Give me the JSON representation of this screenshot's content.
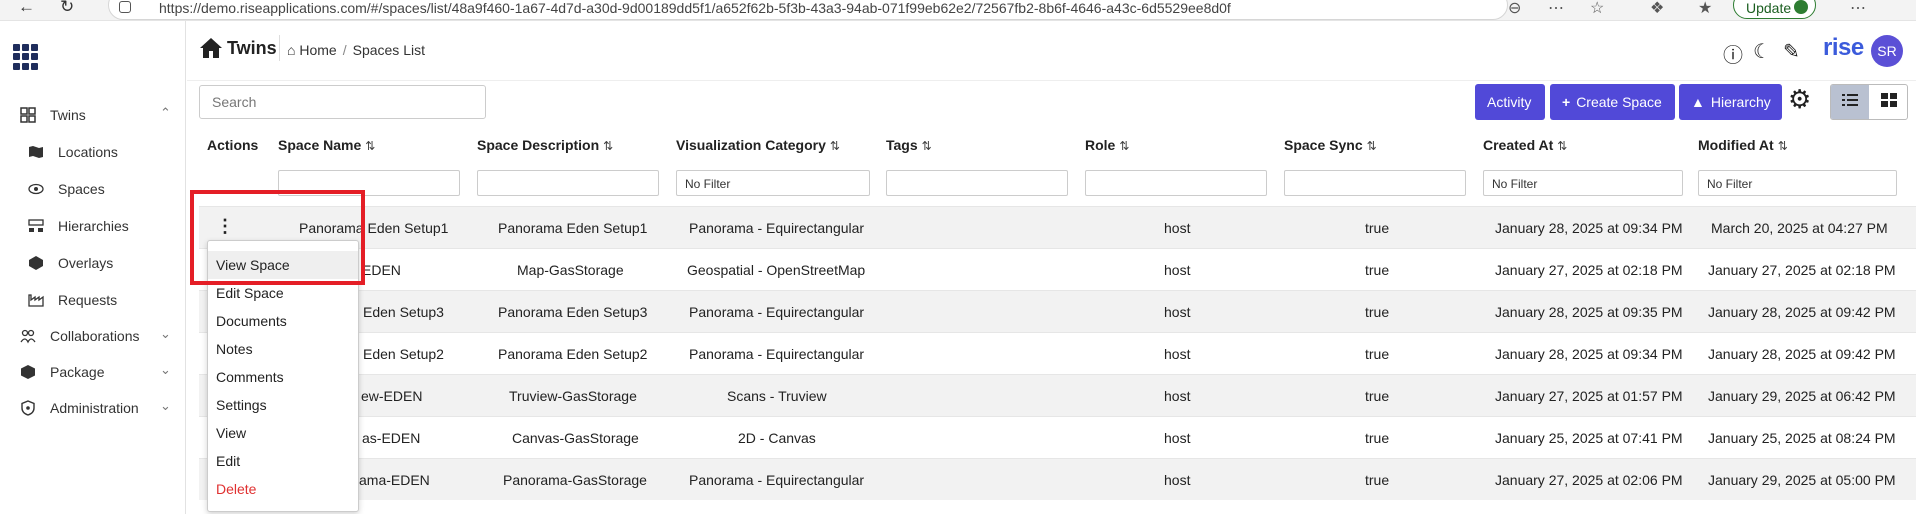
{
  "browser": {
    "url": "https://demo.riseapplications.com/#/spaces/list/48a9f460-1a67-4d7d-a30d-9d00189dd5f1/a652f62b-5f3b-43a3-94ab-071f99eb62e2/72567fb2-8b6f-4646-a43c-6d5529ee8d0f",
    "update_label": "Update"
  },
  "sidebar": {
    "items": [
      {
        "label": "Twins",
        "icon": "grid-icon"
      },
      {
        "label": "Locations",
        "icon": "map-icon"
      },
      {
        "label": "Spaces",
        "icon": "eye-icon"
      },
      {
        "label": "Hierarchies",
        "icon": "hierarchy-icon"
      },
      {
        "label": "Overlays",
        "icon": "layers-icon"
      },
      {
        "label": "Requests",
        "icon": "factory-icon"
      },
      {
        "label": "Collaborations",
        "icon": "people-icon"
      },
      {
        "label": "Package",
        "icon": "package-icon"
      },
      {
        "label": "Administration",
        "icon": "shield-icon"
      }
    ]
  },
  "header": {
    "title": "Twins",
    "breadcrumb": [
      "Home",
      "Spaces List"
    ],
    "brand": "rise",
    "avatar_initials": "SR"
  },
  "toolbar": {
    "search_placeholder": "Search",
    "activity_label": "Activity",
    "create_label": "Create Space",
    "hierarchy_label": "Hierarchy"
  },
  "table": {
    "columns": [
      "Actions",
      "Space Name",
      "Space Description",
      "Visualization Category",
      "Tags",
      "Role",
      "Space Sync",
      "Created At",
      "Modified At"
    ],
    "filter_placeholders": {
      "viz": "No Filter",
      "created": "No Filter",
      "modified": "No Filter"
    },
    "rows": [
      {
        "name": "Panorama Eden Setup1",
        "description": "Panorama Eden Setup1",
        "category": "Panorama - Equirectangular",
        "tags": "",
        "role": "host",
        "sync": "true",
        "created": "January 28, 2025 at 09:34 PM",
        "modified": "March 20, 2025 at 04:27 PM"
      },
      {
        "name": "EDEN",
        "description": "Map-GasStorage",
        "category": "Geospatial - OpenStreetMap",
        "tags": "",
        "role": "host",
        "sync": "true",
        "created": "January 27, 2025 at 02:18 PM",
        "modified": "January 27, 2025 at 02:18 PM"
      },
      {
        "name": "Eden Setup3",
        "description": "Panorama Eden Setup3",
        "category": "Panorama - Equirectangular",
        "tags": "",
        "role": "host",
        "sync": "true",
        "created": "January 28, 2025 at 09:35 PM",
        "modified": "January 28, 2025 at 09:42 PM"
      },
      {
        "name": "Eden Setup2",
        "description": "Panorama Eden Setup2",
        "category": "Panorama - Equirectangular",
        "tags": "",
        "role": "host",
        "sync": "true",
        "created": "January 28, 2025 at 09:34 PM",
        "modified": "January 28, 2025 at 09:42 PM"
      },
      {
        "name": "ew-EDEN",
        "description": "Truview-GasStorage",
        "category": "Scans - Truview",
        "tags": "",
        "role": "host",
        "sync": "true",
        "created": "January 27, 2025 at 01:57 PM",
        "modified": "January 29, 2025 at 06:42 PM"
      },
      {
        "name": "as-EDEN",
        "description": "Canvas-GasStorage",
        "category": "2D - Canvas",
        "tags": "",
        "role": "host",
        "sync": "true",
        "created": "January 25, 2025 at 07:41 PM",
        "modified": "January 25, 2025 at 08:24 PM"
      },
      {
        "name": "ama-EDEN",
        "description": "Panorama-GasStorage",
        "category": "Panorama - Equirectangular",
        "tags": "",
        "role": "host",
        "sync": "true",
        "created": "January 27, 2025 at 02:06 PM",
        "modified": "January 29, 2025 at 05:00 PM"
      }
    ]
  },
  "menu": {
    "items": [
      "View Space",
      "Edit Space",
      "Documents",
      "Notes",
      "Comments",
      "Settings",
      "View",
      "Edit",
      "Delete"
    ]
  },
  "colors": {
    "accent": "#5149d8",
    "brand": "#3b5bdb",
    "danger": "#e03131",
    "highlight_frame": "#e41e26"
  }
}
